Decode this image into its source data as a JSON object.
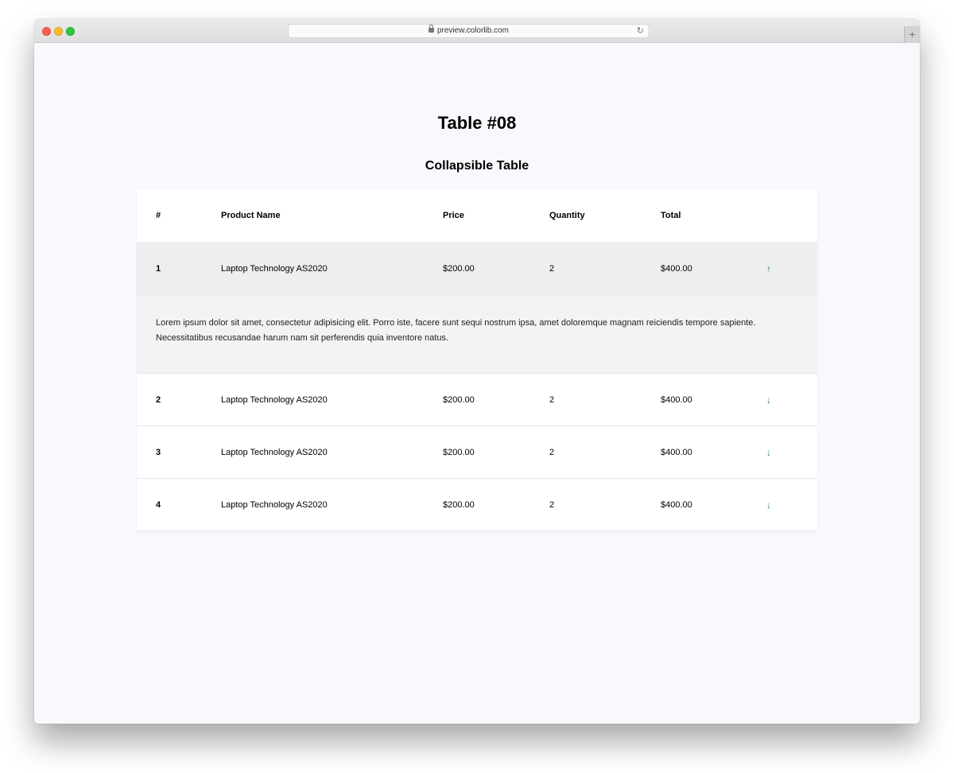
{
  "browser": {
    "url": "preview.colorlib.com",
    "new_tab_label": "+"
  },
  "page": {
    "title": "Table #08",
    "subtitle": "Collapsible Table"
  },
  "table": {
    "columns": [
      "#",
      "Product Name",
      "Price",
      "Quantity",
      "Total"
    ],
    "rows": [
      {
        "num": "1",
        "name": "Laptop Technology AS2020",
        "price": "$200.00",
        "qty": "2",
        "total": "$400.00",
        "arrow": "arrow-up-icon",
        "expanded": true
      },
      {
        "num": "2",
        "name": "Laptop Technology AS2020",
        "price": "$200.00",
        "qty": "2",
        "total": "$400.00",
        "arrow": "arrow-down-icon",
        "expanded": false
      },
      {
        "num": "3",
        "name": "Laptop Technology AS2020",
        "price": "$200.00",
        "qty": "2",
        "total": "$400.00",
        "arrow": "arrow-down-icon",
        "expanded": false
      },
      {
        "num": "4",
        "name": "Laptop Technology AS2020",
        "price": "$200.00",
        "qty": "2",
        "total": "$400.00",
        "arrow": "arrow-down-icon",
        "expanded": false
      }
    ],
    "detail_text": "Lorem ipsum dolor sit amet, consectetur adipisicing elit. Porro iste, facere sunt sequi nostrum ipsa, amet doloremque magnam reiciendis tempore sapiente. Necessitatibus recusandae harum nam sit perferendis quia inventore natus."
  },
  "colors": {
    "arrow": "#2e8b3a",
    "page_bg": "#f8f8fd",
    "active_row_bg": "#eeedf0"
  }
}
